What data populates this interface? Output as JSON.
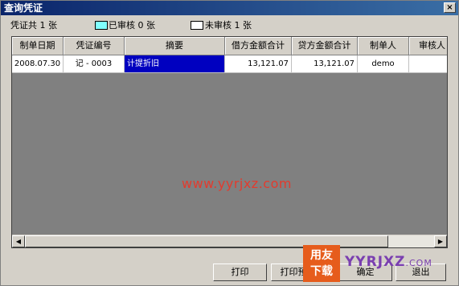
{
  "window": {
    "title": "查询凭证",
    "close_glyph": "×"
  },
  "summary": {
    "total": "凭证共 1 张",
    "audited": "已审核 0 张",
    "unaudited": "未审核 1 张",
    "audited_color": "#80ffff",
    "unaudited_color": "#ffffff"
  },
  "grid": {
    "columns": [
      "制单日期",
      "凭证编号",
      "摘要",
      "借方金额合计",
      "贷方金额合计",
      "制单人",
      "审核人"
    ],
    "rows": [
      {
        "date": "2008.07.30",
        "number": "记 - 0003",
        "summary": "计提折旧",
        "debit": "13,121.07",
        "credit": "13,121.07",
        "maker": "demo",
        "auditor": ""
      }
    ]
  },
  "watermark": "www.yyrjxz.com",
  "buttons": {
    "print": "打印",
    "print_preview": "打印预览",
    "confirm": "确定",
    "exit": "退出"
  },
  "logo": {
    "top": "用友",
    "bottom": "下载",
    "site_main": "YYRJXZ",
    "site_suffix": ".COM"
  },
  "colors": {
    "titlebar": "#0a246a",
    "selected_cell": "#0000c0",
    "grid_background": "#808080"
  }
}
